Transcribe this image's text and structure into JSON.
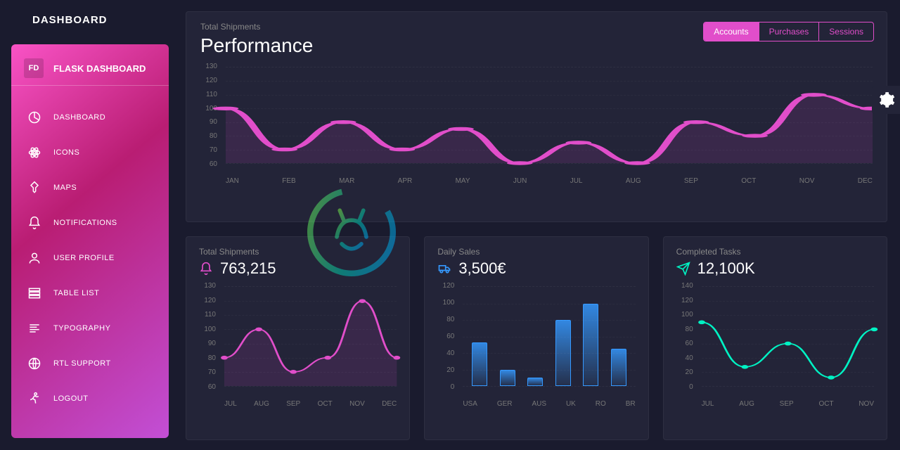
{
  "page_header": "DASHBOARD",
  "brand_logo": "FD",
  "brand_text": "FLASK DASHBOARD",
  "nav": [
    {
      "label": "DASHBOARD",
      "icon": "pie"
    },
    {
      "label": "ICONS",
      "icon": "atom"
    },
    {
      "label": "MAPS",
      "icon": "pin"
    },
    {
      "label": "NOTIFICATIONS",
      "icon": "bell"
    },
    {
      "label": "USER PROFILE",
      "icon": "user"
    },
    {
      "label": "TABLE LIST",
      "icon": "table"
    },
    {
      "label": "TYPOGRAPHY",
      "icon": "align"
    },
    {
      "label": "RTL SUPPORT",
      "icon": "globe"
    },
    {
      "label": "LOGOUT",
      "icon": "run"
    }
  ],
  "main_chart": {
    "subtitle": "Total Shipments",
    "title": "Performance",
    "toggles": [
      "Accounts",
      "Purchases",
      "Sessions"
    ],
    "active_toggle": 0,
    "color": "#e14eca"
  },
  "card_shipments": {
    "label": "Total Shipments",
    "value": "763,215",
    "icon_color": "#e14eca"
  },
  "card_sales": {
    "label": "Daily Sales",
    "value": "3,500€",
    "icon_color": "#3599ff"
  },
  "card_tasks": {
    "label": "Completed Tasks",
    "value": "12,100K",
    "icon_color": "#00f2c3"
  },
  "chart_data": [
    {
      "id": "performance",
      "type": "line",
      "categories": [
        "JAN",
        "FEB",
        "MAR",
        "APR",
        "MAY",
        "JUN",
        "JUL",
        "AUG",
        "SEP",
        "OCT",
        "NOV",
        "DEC"
      ],
      "values": [
        100,
        70,
        90,
        70,
        85,
        60,
        75,
        60,
        90,
        80,
        110,
        100
      ],
      "ylim": [
        60,
        130
      ],
      "yticks": [
        130,
        120,
        110,
        100,
        90,
        80,
        70,
        60
      ],
      "title": "Performance",
      "xlabel": "",
      "ylabel": ""
    },
    {
      "id": "total_shipments",
      "type": "line",
      "categories": [
        "JUL",
        "AUG",
        "SEP",
        "OCT",
        "NOV",
        "DEC"
      ],
      "values": [
        80,
        100,
        70,
        80,
        120,
        80
      ],
      "ylim": [
        60,
        130
      ],
      "yticks": [
        130,
        120,
        110,
        100,
        90,
        80,
        70,
        60
      ],
      "title": "Total Shipments",
      "xlabel": "",
      "ylabel": ""
    },
    {
      "id": "daily_sales",
      "type": "bar",
      "categories": [
        "USA",
        "GER",
        "AUS",
        "UK",
        "RO",
        "BR"
      ],
      "values": [
        53,
        20,
        10,
        80,
        100,
        45
      ],
      "ylim": [
        0,
        120
      ],
      "yticks": [
        120,
        100,
        80,
        60,
        40,
        20,
        0
      ],
      "title": "Daily Sales",
      "xlabel": "",
      "ylabel": ""
    },
    {
      "id": "completed_tasks",
      "type": "line",
      "categories": [
        "JUL",
        "AUG",
        "SEP",
        "OCT",
        "NOV"
      ],
      "values": [
        90,
        27,
        60,
        12,
        80
      ],
      "ylim": [
        0,
        140
      ],
      "yticks": [
        140,
        120,
        100,
        80,
        60,
        40,
        20,
        0
      ],
      "title": "Completed Tasks",
      "xlabel": "",
      "ylabel": ""
    }
  ]
}
